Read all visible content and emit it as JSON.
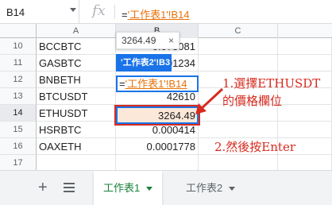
{
  "formula_bar": {
    "name_box": "B14",
    "fx": "fx",
    "formula_prefix": "=",
    "formula_ref": "'工作表1'!B14"
  },
  "columns": [
    "A",
    "B",
    "C"
  ],
  "rows": [
    {
      "num": "10",
      "a": "BCCBTC",
      "b": "0.075081"
    },
    {
      "num": "11",
      "a": "GASBTC",
      "b": "0.001234"
    },
    {
      "num": "12",
      "a": "BNBETH",
      "b": ""
    },
    {
      "num": "13",
      "a": "BTCUSDT",
      "b": "42610"
    },
    {
      "num": "14",
      "a": "ETHUSDT",
      "b": "3264.49"
    },
    {
      "num": "15",
      "a": "HSRBTC",
      "b": "0.000414"
    },
    {
      "num": "16",
      "a": "OAXETH",
      "b": "0.0001778"
    },
    {
      "num": "17",
      "a": "",
      "b": ""
    }
  ],
  "edit_cell": {
    "prefix": "=",
    "ref": "'工作表1'!B14"
  },
  "tooltip": {
    "value": "3264.49",
    "close": "×",
    "ref_label": "'工作表2'!B3"
  },
  "annotations": {
    "step1_line1": "1.選擇ETHUSDT",
    "step1_line2": "的價格欄位",
    "step2": "2.然後按Enter"
  },
  "sheet_tabs": [
    {
      "label": "工作表1",
      "active": true
    },
    {
      "label": "工作表2",
      "active": false
    }
  ],
  "add_sheet": "+",
  "colors": {
    "accent": "#1a73e8",
    "annotation": "#d62b1f",
    "reference": "#e8710a",
    "active_tab": "#188038"
  }
}
